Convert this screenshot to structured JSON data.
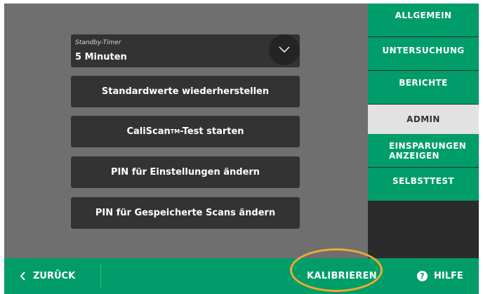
{
  "standby": {
    "label": "Standby-Timer",
    "value": "5 Minuten"
  },
  "actions": {
    "restore_defaults": "Standardwerte wiederherstellen",
    "caliscan_prefix": "CaliScan",
    "caliscan_tm": "TM",
    "caliscan_suffix": "-Test starten",
    "pin_settings": "PIN für Einstellungen ändern",
    "pin_scans": "PIN für Gespeicherte Scans ändern"
  },
  "sidebar": {
    "items": [
      {
        "label": "ALLGEMEIN",
        "active": false
      },
      {
        "label": "UNTERSUCHUNG",
        "active": false
      },
      {
        "label": "BERICHTE",
        "active": false
      },
      {
        "label": "ADMIN",
        "active": true
      },
      {
        "label": "EINSPARUNGEN ANZEIGEN",
        "active": false
      },
      {
        "label": "SELBSTTEST",
        "active": false
      }
    ]
  },
  "bottom": {
    "back_label": "ZURÜCK",
    "calibrate_label": "KALIBRIEREN",
    "help_label": "HILFE",
    "help_glyph": "?"
  },
  "colors": {
    "brand_green": "#009d6a",
    "panel_gray": "#6f6f6f",
    "button_dark": "#333333",
    "active_tab": "#e2e2e2",
    "highlight_ring": "#f2aa2c"
  },
  "icons": [
    "chevron-down-icon",
    "chevron-left-icon",
    "help-icon"
  ]
}
